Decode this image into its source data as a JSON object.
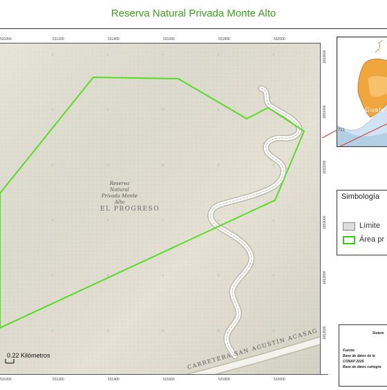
{
  "title": "Reserva Natural Privada Monte Alto",
  "map": {
    "reserve_label_lines": [
      "Reserva",
      "Natural",
      "Privada Monte",
      "Alto"
    ],
    "department_label": "EL PROGRESO",
    "road_label": "CARRETERA SAN AGUSTÍN ACASAG",
    "scale_text": "0.22 Kilómetros",
    "colors": {
      "boundary": "#55dd22",
      "terrain": "#e3e0d3",
      "road": "#ffffff"
    }
  },
  "axes": {
    "x_top": [
      "531000",
      "531200",
      "531400",
      "531600",
      "531800",
      "532000"
    ],
    "x_bottom": [
      "531000",
      "531200",
      "531400",
      "531600",
      "531800",
      "532000"
    ],
    "y_right": [
      "1653600",
      "1653400",
      "1653200",
      "1653000",
      "1652800",
      "1652600"
    ]
  },
  "inset": {
    "country_label": "Guate",
    "number_label": "721"
  },
  "legend": {
    "title": "Simbología",
    "items": [
      {
        "label": "Límite",
        "color": "#dddddd",
        "border": "#888888"
      },
      {
        "label": "Área pr",
        "color": "#ffffff",
        "border": "#33cc11"
      }
    ]
  },
  "source": {
    "heading": "Sistem",
    "fuente": "Fuente:",
    "line1": "Base de datos de la",
    "line2": "CONAP 2026",
    "line3": "Base de datos cartogra"
  }
}
